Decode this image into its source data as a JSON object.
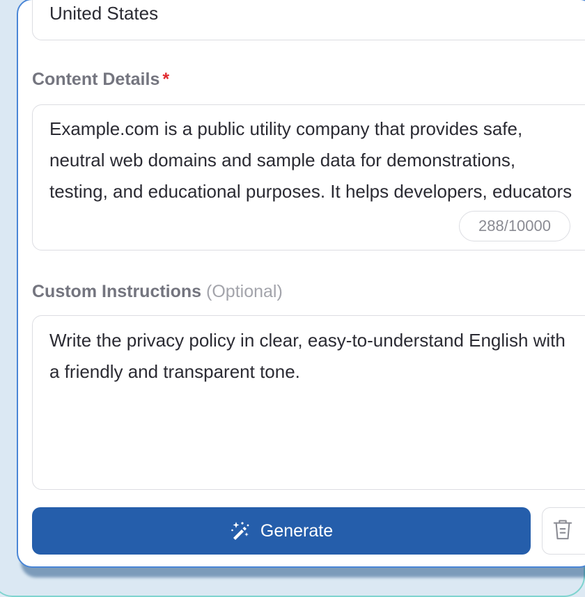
{
  "form": {
    "country_value": "United States",
    "content_details": {
      "label": "Content Details",
      "required_mark": "*",
      "value": "Example.com is a public utility company that provides safe, neutral web domains and sample data for demonstrations, testing, and educational purposes. It helps developers, educators",
      "counter": "288/10000"
    },
    "custom_instructions": {
      "label": "Custom Instructions",
      "optional_note": "(Optional)",
      "value": "Write the privacy policy in clear, easy-to-understand English with a friendly and transparent tone."
    },
    "generate_label": "Generate",
    "icons": {
      "generate": "magic-wand-icon",
      "clear": "trash-icon"
    },
    "colors": {
      "primary_button": "#255eab",
      "required_mark": "#e0282e",
      "label_text": "#74757f"
    }
  }
}
